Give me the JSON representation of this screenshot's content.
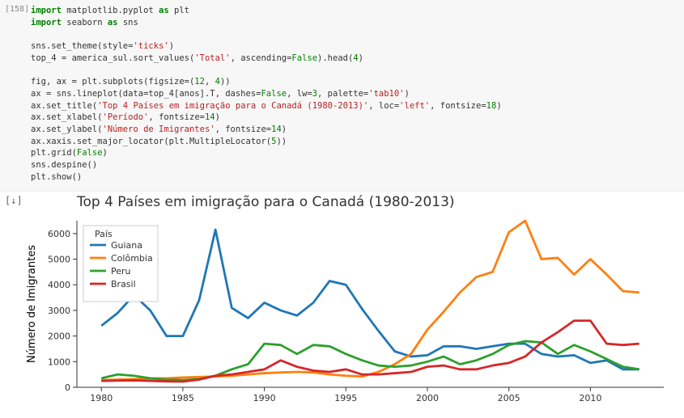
{
  "cell": {
    "prompt": "[158]",
    "lines": [
      [
        [
          "kw",
          "import"
        ],
        [
          "",
          " matplotlib.pyplot "
        ],
        [
          "kw",
          "as"
        ],
        [
          "",
          " plt"
        ]
      ],
      [
        [
          "kw",
          "import"
        ],
        [
          "",
          " seaborn "
        ],
        [
          "kw",
          "as"
        ],
        [
          "",
          " sns"
        ]
      ],
      [
        [
          "",
          ""
        ]
      ],
      [
        [
          "",
          "sns.set_theme(style="
        ],
        [
          "str",
          "'ticks'"
        ],
        [
          "",
          ")"
        ]
      ],
      [
        [
          "",
          "top_4 = america_sul.sort_values("
        ],
        [
          "str",
          "'Total'"
        ],
        [
          "",
          ", ascending="
        ],
        [
          "bool",
          "False"
        ],
        [
          "",
          ").head("
        ],
        [
          "num",
          "4"
        ],
        [
          "",
          ")"
        ]
      ],
      [
        [
          "",
          ""
        ]
      ],
      [
        [
          "",
          "fig, ax = plt.subplots(figsize=("
        ],
        [
          "num",
          "12"
        ],
        [
          "",
          ", "
        ],
        [
          "num",
          "4"
        ],
        [
          "",
          "))"
        ]
      ],
      [
        [
          "",
          "ax = sns.lineplot(data=top_4[anos].T, dashes="
        ],
        [
          "bool",
          "False"
        ],
        [
          "",
          ", lw="
        ],
        [
          "num",
          "3"
        ],
        [
          "",
          ", palette="
        ],
        [
          "str",
          "'tab10'"
        ],
        [
          "",
          ")"
        ]
      ],
      [
        [
          "",
          "ax.set_title("
        ],
        [
          "str",
          "'Top 4 Países em imigração para o Canadá (1980-2013)'"
        ],
        [
          "",
          ", loc="
        ],
        [
          "str",
          "'left'"
        ],
        [
          "",
          ", fontsize="
        ],
        [
          "num",
          "18"
        ],
        [
          "",
          ")"
        ]
      ],
      [
        [
          "",
          "ax.set_xlabel("
        ],
        [
          "str",
          "'Período'"
        ],
        [
          "",
          ", fontsize="
        ],
        [
          "num",
          "14"
        ],
        [
          "",
          ")"
        ]
      ],
      [
        [
          "",
          "ax.set_ylabel("
        ],
        [
          "str",
          "'Número de Imigrantes'"
        ],
        [
          "",
          ", fontsize="
        ],
        [
          "num",
          "14"
        ],
        [
          "",
          ")"
        ]
      ],
      [
        [
          "",
          "ax.xaxis.set_major_locator(plt.MultipleLocator("
        ],
        [
          "num",
          "5"
        ],
        [
          "",
          "))"
        ]
      ],
      [
        [
          "",
          "plt.grid("
        ],
        [
          "bool",
          "False"
        ],
        [
          "",
          ")"
        ]
      ],
      [
        [
          "",
          "sns.despine()"
        ]
      ],
      [
        [
          "",
          "plt.show()"
        ]
      ]
    ]
  },
  "out_icon": "[↓]",
  "chart_data": {
    "type": "line",
    "title": "Top 4 Países em imigração para o Canadá (1980-2013)",
    "xlabel": "Período",
    "ylabel": "Número de Imigrantes",
    "legend_title": "País",
    "x": [
      1980,
      1981,
      1982,
      1983,
      1984,
      1985,
      1986,
      1987,
      1988,
      1989,
      1990,
      1991,
      1992,
      1993,
      1994,
      1995,
      1996,
      1997,
      1998,
      1999,
      2000,
      2001,
      2002,
      2003,
      2004,
      2005,
      2006,
      2007,
      2008,
      2009,
      2010,
      2011,
      2012,
      2013
    ],
    "xticks": [
      1980,
      1985,
      1990,
      1995,
      2000,
      2005,
      2010
    ],
    "yticks": [
      0,
      1000,
      2000,
      3000,
      4000,
      5000,
      6000
    ],
    "xlim": [
      1978.5,
      2014.5
    ],
    "ylim": [
      0,
      6500
    ],
    "series": [
      {
        "name": "Guiana",
        "color": "#1f77b4",
        "values": [
          2400,
          2900,
          3600,
          3000,
          2000,
          2000,
          3400,
          6150,
          3100,
          2700,
          3300,
          3000,
          2800,
          3300,
          4150,
          4000,
          3050,
          2200,
          1400,
          1200,
          1250,
          1600,
          1600,
          1500,
          1600,
          1700,
          1700,
          1300,
          1200,
          1250,
          950,
          1050,
          700,
          700
        ]
      },
      {
        "name": "Colômbia",
        "color": "#ff7f0e",
        "values": [
          280,
          300,
          320,
          350,
          350,
          380,
          400,
          420,
          450,
          500,
          550,
          580,
          600,
          580,
          500,
          450,
          420,
          600,
          900,
          1300,
          2250,
          2950,
          3700,
          4300,
          4500,
          6050,
          6500,
          5000,
          5050,
          4400,
          5000,
          4400,
          3750,
          3700
        ]
      },
      {
        "name": "Peru",
        "color": "#2ca02c",
        "values": [
          350,
          500,
          450,
          350,
          300,
          280,
          320,
          450,
          700,
          900,
          1700,
          1650,
          1300,
          1650,
          1600,
          1300,
          1050,
          850,
          800,
          850,
          1000,
          1200,
          900,
          1050,
          1300,
          1650,
          1800,
          1750,
          1300,
          1650,
          1400,
          1100,
          800,
          700
        ]
      },
      {
        "name": "Brasil",
        "color": "#d62728",
        "values": [
          250,
          260,
          270,
          250,
          230,
          220,
          300,
          450,
          500,
          600,
          700,
          1050,
          800,
          650,
          600,
          700,
          500,
          500,
          550,
          600,
          800,
          850,
          700,
          700,
          850,
          950,
          1200,
          1750,
          2150,
          2600,
          2600,
          1700,
          1650,
          1700
        ]
      }
    ]
  }
}
